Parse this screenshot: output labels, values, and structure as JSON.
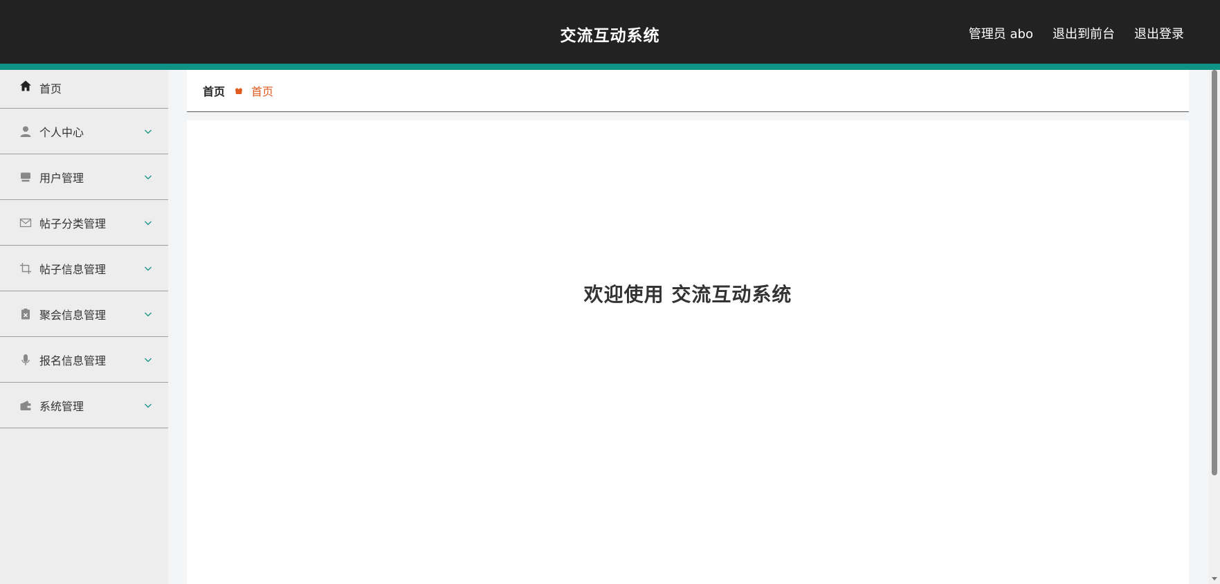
{
  "header": {
    "title": "交流互动系统",
    "user_label": "管理员 abo",
    "front_label": "退出到前台",
    "logout_label": "退出登录",
    "accent_color": "#0f9384"
  },
  "sidebar": {
    "items": [
      {
        "label": "首页",
        "icon": "home-icon"
      },
      {
        "label": "个人中心",
        "icon": "user-icon"
      },
      {
        "label": "用户管理",
        "icon": "monitor-icon"
      },
      {
        "label": "帖子分类管理",
        "icon": "mail-icon"
      },
      {
        "label": "帖子信息管理",
        "icon": "crop-icon"
      },
      {
        "label": "聚会信息管理",
        "icon": "clipboard-x-icon"
      },
      {
        "label": "报名信息管理",
        "icon": "microphone-icon"
      },
      {
        "label": "系统管理",
        "icon": "wallet-icon"
      }
    ]
  },
  "breadcrumb": {
    "root": "首页",
    "current": "首页",
    "current_color": "#e15a1e"
  },
  "main": {
    "welcome": "欢迎使用 交流互动系统"
  }
}
